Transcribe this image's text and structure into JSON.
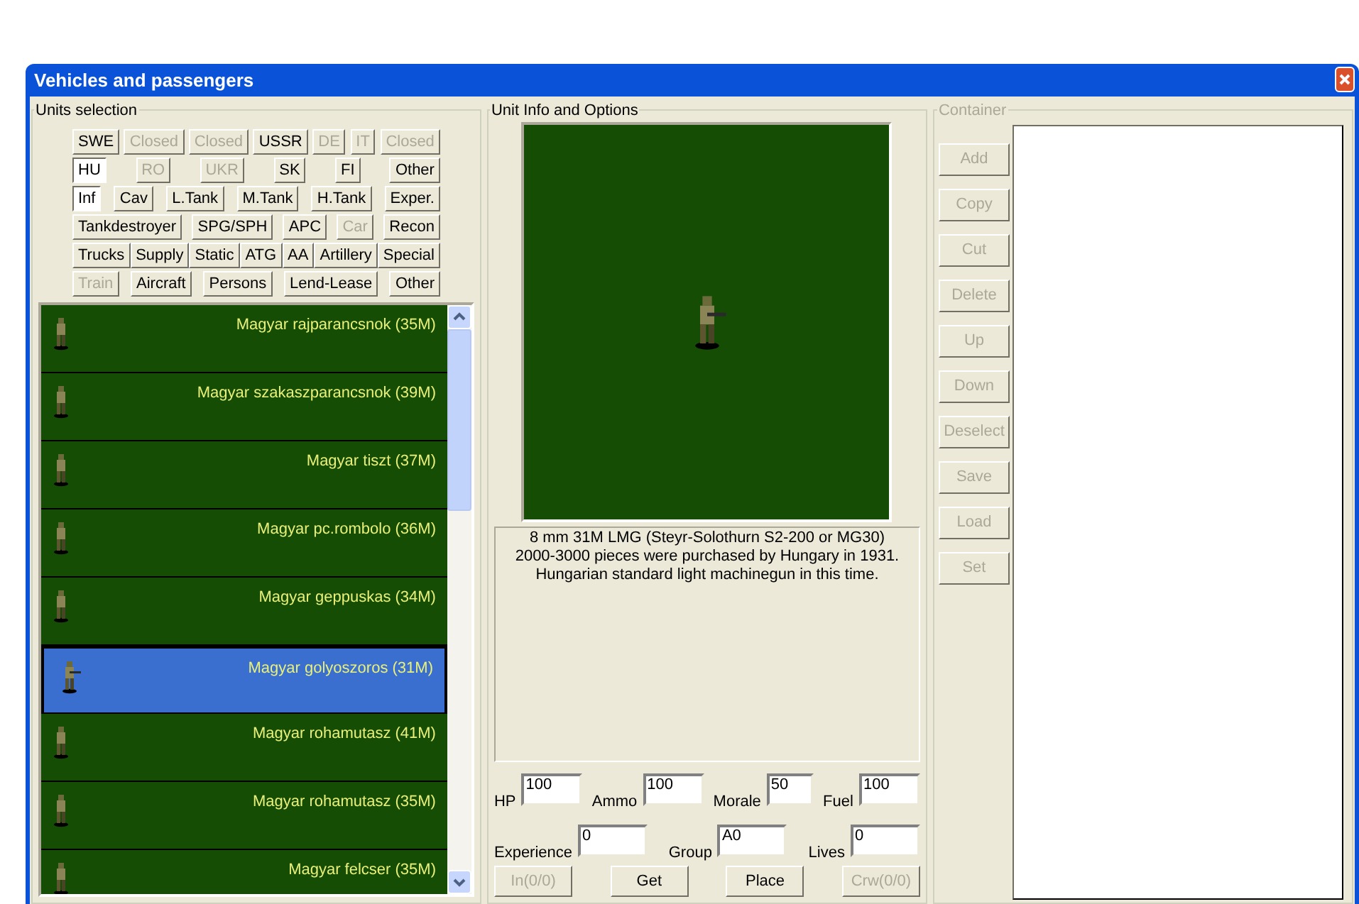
{
  "window": {
    "title": "Vehicles and passengers"
  },
  "units_selection": {
    "title": "Units selection",
    "filter_rows": [
      [
        {
          "label": "SWE",
          "disabled": false,
          "selected": false
        },
        {
          "label": "Closed",
          "disabled": true,
          "selected": false
        },
        {
          "label": "Closed",
          "disabled": true,
          "selected": false
        },
        {
          "label": "USSR",
          "disabled": false,
          "selected": false
        },
        {
          "label": "DE",
          "disabled": true,
          "selected": false
        },
        {
          "label": "IT",
          "disabled": true,
          "selected": false
        },
        {
          "label": "Closed",
          "disabled": true,
          "selected": false
        }
      ],
      [
        {
          "label": "HU",
          "disabled": false,
          "selected": true
        },
        {
          "label": "RO",
          "disabled": true,
          "selected": false
        },
        {
          "label": "UKR",
          "disabled": true,
          "selected": false
        },
        {
          "label": "SK",
          "disabled": false,
          "selected": false
        },
        {
          "label": "FI",
          "disabled": false,
          "selected": false
        },
        {
          "label": "Other",
          "disabled": false,
          "selected": false
        }
      ],
      [
        {
          "label": "Inf",
          "disabled": false,
          "selected": true
        },
        {
          "label": "Cav",
          "disabled": false,
          "selected": false
        },
        {
          "label": "L.Tank",
          "disabled": false,
          "selected": false
        },
        {
          "label": "M.Tank",
          "disabled": false,
          "selected": false
        },
        {
          "label": "H.Tank",
          "disabled": false,
          "selected": false
        },
        {
          "label": "Exper.",
          "disabled": false,
          "selected": false
        }
      ],
      [
        {
          "label": "Tankdestroyer",
          "disabled": false,
          "selected": false
        },
        {
          "label": "SPG/SPH",
          "disabled": false,
          "selected": false
        },
        {
          "label": "APC",
          "disabled": false,
          "selected": false
        },
        {
          "label": "Car",
          "disabled": true,
          "selected": false
        },
        {
          "label": "Recon",
          "disabled": false,
          "selected": false
        }
      ],
      [
        {
          "label": "Trucks",
          "disabled": false,
          "selected": false
        },
        {
          "label": "Supply",
          "disabled": false,
          "selected": false
        },
        {
          "label": "Static",
          "disabled": false,
          "selected": false
        },
        {
          "label": "ATG",
          "disabled": false,
          "selected": false
        },
        {
          "label": "AA",
          "disabled": false,
          "selected": false
        },
        {
          "label": "Artillery",
          "disabled": false,
          "selected": false
        },
        {
          "label": "Special",
          "disabled": false,
          "selected": false
        }
      ],
      [
        {
          "label": "Train",
          "disabled": true,
          "selected": false
        },
        {
          "label": "Aircraft",
          "disabled": false,
          "selected": false
        },
        {
          "label": "Persons",
          "disabled": false,
          "selected": false
        },
        {
          "label": "Lend-Lease",
          "disabled": false,
          "selected": false
        },
        {
          "label": "Other",
          "disabled": false,
          "selected": false
        }
      ]
    ],
    "units": [
      {
        "name": "Magyar rajparancsnok (35M)",
        "selected": false
      },
      {
        "name": "Magyar szakaszparancsnok (39M)",
        "selected": false
      },
      {
        "name": "Magyar tiszt (37M)",
        "selected": false
      },
      {
        "name": "Magyar pc.rombolo (36M)",
        "selected": false
      },
      {
        "name": "Magyar geppuskas (34M)",
        "selected": false
      },
      {
        "name": "Magyar golyoszoros (31M)",
        "selected": true
      },
      {
        "name": "Magyar rohamutasz (41M)",
        "selected": false
      },
      {
        "name": "Magyar rohamutasz (35M)",
        "selected": false
      },
      {
        "name": "Magyar felcser (35M)",
        "selected": false
      }
    ]
  },
  "unit_info": {
    "title": "Unit Info and Options",
    "description": "8 mm 31M LMG (Steyr-Solothurn S2-200 or MG30)\n2000-3000 pieces were purchased by Hungary in 1931.\nHungarian standard light machinegun in this time.",
    "field_rows": [
      [
        {
          "label": "HP",
          "value": "100"
        },
        {
          "label": "Ammo",
          "value": "100"
        },
        {
          "label": "Morale",
          "value": "50"
        },
        {
          "label": "Fuel",
          "value": "100"
        }
      ],
      [
        {
          "label": "Experience",
          "value": "0"
        },
        {
          "label": "Group",
          "value": "A0"
        },
        {
          "label": "Lives",
          "value": "0"
        }
      ]
    ],
    "buttons": [
      {
        "label": "In(0/0)",
        "disabled": true
      },
      {
        "label": "Get",
        "disabled": false
      },
      {
        "label": "Place",
        "disabled": false
      },
      {
        "label": "Crw(0/0)",
        "disabled": true
      }
    ]
  },
  "container": {
    "title": "Container",
    "buttons": [
      {
        "label": "Add",
        "disabled": true
      },
      {
        "label": "Copy",
        "disabled": true
      },
      {
        "label": "Cut",
        "disabled": true
      },
      {
        "label": "Delete",
        "disabled": true
      },
      {
        "label": "Up",
        "disabled": true
      },
      {
        "label": "Down",
        "disabled": true
      },
      {
        "label": "Deselect",
        "disabled": true
      },
      {
        "label": "Save",
        "disabled": true
      },
      {
        "label": "Load",
        "disabled": true
      },
      {
        "label": "Set",
        "disabled": true
      }
    ]
  }
}
